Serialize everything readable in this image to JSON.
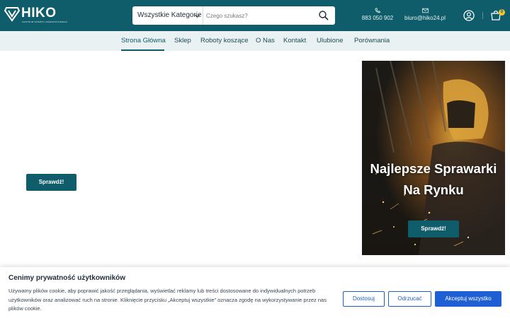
{
  "header": {
    "logo_text": "HIKO",
    "logo_sub": "CENTRUM SPRZĘTU WARSZTATOWEGO",
    "search": {
      "category_label": "Wszystkie Kategorie",
      "placeholder": "Czego szukasz?"
    },
    "phone": "883 050 902",
    "email": "biuro@hiko24.pl",
    "cart_count": "0"
  },
  "nav": {
    "items": [
      {
        "label": "Strona Główna",
        "active": true
      },
      {
        "label": "Sklep"
      },
      {
        "label": "Roboty koszące"
      },
      {
        "label": "O Nas"
      },
      {
        "label": "Kontakt"
      },
      {
        "label": "Ulubione"
      },
      {
        "label": "Porównania"
      }
    ]
  },
  "hero": {
    "button_label": "Sprawdź!"
  },
  "promo": {
    "title": "Najlepsze Sprawarki Na Rynku",
    "button_label": "Sprawdź!"
  },
  "cookie": {
    "title": "Cenimy prywatność użytkowników",
    "text": "Używamy plików cookie, aby poprawić jakość przeglądania, wyświetlać reklamy lub treści dostosowane do indywidualnych potrzeb użytkowników oraz analizować ruch na stronie. Kliknięcie przycisku „Akceptuj wszystkie” oznacza zgodę na wykorzystywanie przez nas plików cookie.",
    "customize_label": "Dostosuj",
    "reject_label": "Odrzucać",
    "accept_label": "Akceptuj wszystko"
  },
  "colors": {
    "brand": "#0f5d6a",
    "nav_bg": "#e9f1f2",
    "cookie_primary": "#1e5fd3",
    "badge": "#f4c430"
  },
  "icons": {
    "logo": "hiko-logo-icon",
    "search": "search-icon",
    "phone": "phone-icon",
    "mail": "mail-icon",
    "user": "user-icon",
    "cart": "cart-icon",
    "dropdown": "chevron-down-icon"
  }
}
